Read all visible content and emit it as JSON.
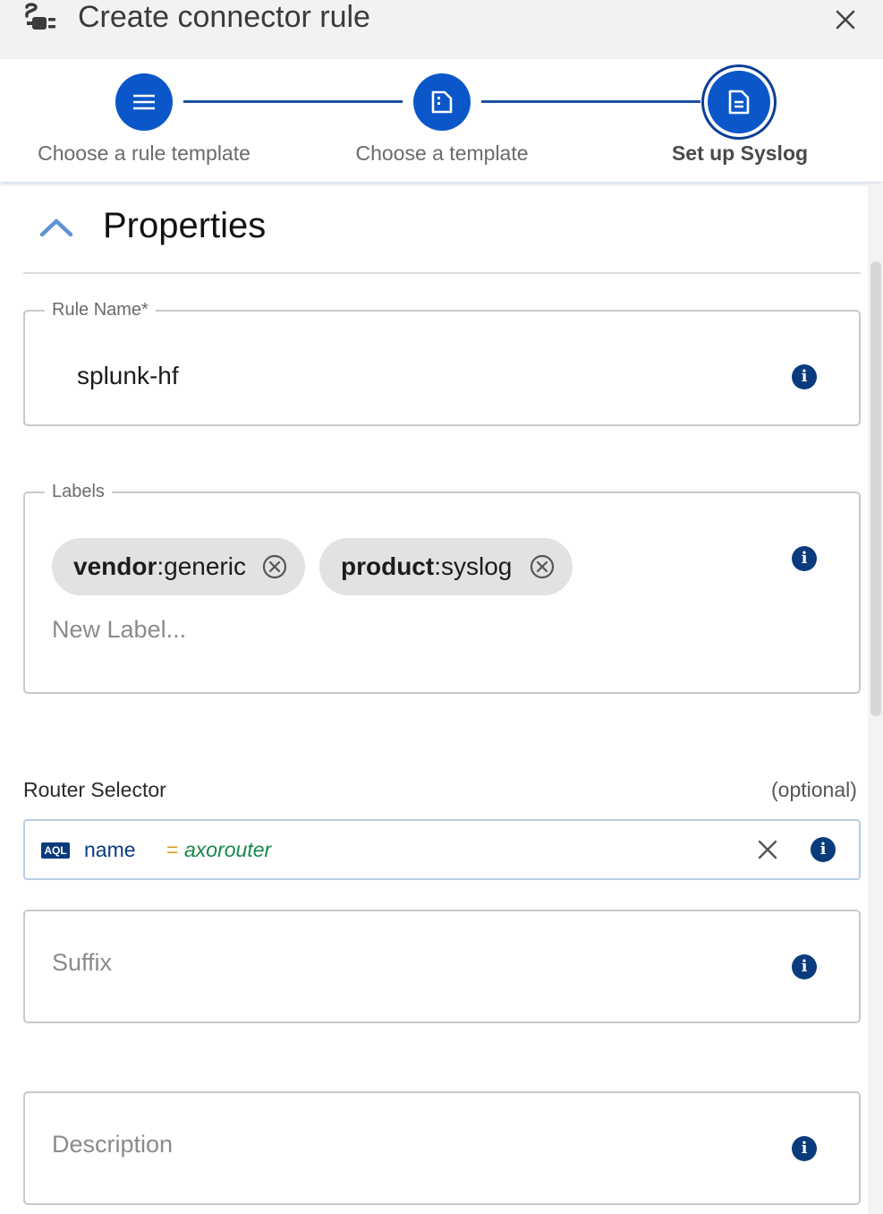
{
  "header": {
    "title": "Create connector rule",
    "logo_icon": "connector-plug-icon",
    "close_icon": "close-icon"
  },
  "stepper": {
    "steps": [
      {
        "label": "Choose a rule template",
        "icon": "list-icon",
        "state": "complete"
      },
      {
        "label": "Choose a template",
        "icon": "file-icon",
        "state": "complete"
      },
      {
        "label": "Set up Syslog",
        "icon": "document-icon",
        "state": "active"
      }
    ]
  },
  "section": {
    "title": "Properties",
    "toggle_icon": "chevron-up-icon"
  },
  "rule_name": {
    "label": "Rule Name*",
    "value": "splunk-hf",
    "info_icon": "info-icon"
  },
  "labels": {
    "label": "Labels",
    "chips": [
      {
        "key": "vendor",
        "separator": ":",
        "value": "generic"
      },
      {
        "key": "product",
        "separator": ":",
        "value": "syslog"
      }
    ],
    "input_placeholder": "New Label...",
    "info_icon": "info-icon"
  },
  "router_selector": {
    "label": "Router Selector",
    "optional_text": "(optional)",
    "badge": "AQL",
    "query": {
      "key": "name",
      "operator": "=",
      "value": "axorouter"
    },
    "clear_icon": "close-icon",
    "info_icon": "info-icon"
  },
  "suffix": {
    "placeholder": "Suffix",
    "info_icon": "info-icon"
  },
  "description": {
    "placeholder": "Description",
    "info_icon": "info-icon"
  },
  "colors": {
    "accent": "#0b57c9",
    "navy": "#0a3b7d",
    "query_value": "#138a47",
    "query_operator": "#e19a12"
  }
}
